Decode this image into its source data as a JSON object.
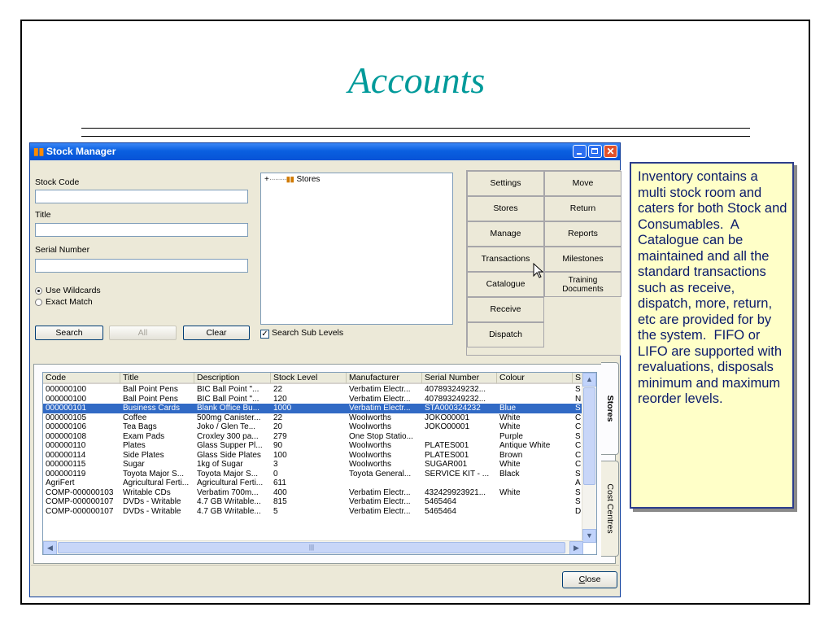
{
  "slide": {
    "title": "Accounts",
    "callout": "Inventory contains a multi stock room and caters for both Stock and Consumables.  A Catalogue can be maintained and all the standard transactions such as receive, dispatch, more, return, etc are provided for by the system.  FIFO or LIFO are supported with revaluations, disposals minimum and maximum reorder levels."
  },
  "window": {
    "title": "Stock Manager",
    "close_glyph": "✕"
  },
  "search_form": {
    "stock_code_label": "Stock Code",
    "stock_code_value": "",
    "title_label": "Title",
    "title_value": "",
    "serial_number_label": "Serial Number",
    "serial_number_value": "",
    "use_wildcards_label": "Use Wildcards",
    "exact_match_label": "Exact Match",
    "selected_match_mode": "Use Wildcards",
    "search_button": "Search",
    "all_button": "All",
    "clear_button": "Clear",
    "search_sub_levels_label": "Search Sub Levels",
    "search_sub_levels_checked": true
  },
  "tree": {
    "root_label": "Stores",
    "expand_glyph": "+"
  },
  "commands": {
    "settings": "Settings",
    "move": "Move",
    "stores": "Stores",
    "return": "Return",
    "manage": "Manage",
    "reports": "Reports",
    "transactions": "Transactions",
    "milestones": "Milestones",
    "catalogue": "Catalogue",
    "training_documents": "Training Documents",
    "receive": "Receive",
    "dispatch": "Dispatch"
  },
  "table": {
    "columns": [
      "Code",
      "Title",
      "Description",
      "Stock Level",
      "Manufacturer",
      "Serial Number",
      "Colour",
      "S"
    ],
    "rows": [
      [
        "000000100",
        "Ball Point Pens",
        "BIC Ball Point \"...",
        "22",
        "Verbatim Electr...",
        "407893249232...",
        "",
        "S"
      ],
      [
        "000000100",
        "Ball Point Pens",
        "BIC Ball Point \"...",
        "120",
        "Verbatim Electr...",
        "407893249232...",
        "",
        "N"
      ],
      [
        "000000101",
        "Business Cards",
        "Blank Office Bu...",
        "1000",
        "Verbatim Electr...",
        "STA000324232",
        "Blue",
        "S"
      ],
      [
        "000000105",
        "Coffee",
        "500mg Canister...",
        "22",
        "Woolworths",
        "JOKO00001",
        "White",
        "C"
      ],
      [
        "000000106",
        "Tea Bags",
        "Joko / Glen Te...",
        "20",
        "Woolworths",
        "JOKO00001",
        "White",
        "C"
      ],
      [
        "000000108",
        "Exam Pads",
        "Croxley 300 pa...",
        "279",
        "One Stop Statio...",
        "",
        "Purple",
        "S"
      ],
      [
        "000000110",
        "Plates",
        "Glass Supper Pl...",
        "90",
        "Woolworths",
        "PLATES001",
        "Antique White",
        "C"
      ],
      [
        "000000114",
        "Side Plates",
        "Glass Side Plates",
        "100",
        "Woolworths",
        "PLATES001",
        "Brown",
        "C"
      ],
      [
        "000000115",
        "Sugar",
        "1kg of Sugar",
        "3",
        "Woolworths",
        "SUGAR001",
        "White",
        "C"
      ],
      [
        "000000119",
        "Toyota Major S...",
        "Toyota Major S...",
        "0",
        "Toyota General...",
        "SERVICE KIT - ...",
        "Black",
        "S"
      ],
      [
        "AgriFert",
        "Agricultural Ferti...",
        "Agricultural Ferti...",
        "611",
        "",
        "",
        "",
        "A"
      ],
      [
        "COMP-000000103",
        "Writable CDs",
        "Verbatim 700m...",
        "400",
        "Verbatim Electr...",
        "432429923921...",
        "White",
        "S"
      ],
      [
        "COMP-000000107",
        "DVDs - Writable",
        "4.7 GB Writable...",
        "815",
        "Verbatim Electr...",
        "5465464",
        "",
        "S"
      ],
      [
        "COMP-000000107",
        "DVDs - Writable",
        "4.7 GB Writable...",
        "5",
        "Verbatim Electr...",
        "5465464",
        "",
        "D"
      ]
    ],
    "selected_row": 2
  },
  "side_tabs": {
    "stores": "Stores",
    "cost_centres": "Cost Centres"
  },
  "footer": {
    "close_first": "C",
    "close_rest": "lose"
  },
  "colors": {
    "title_teal": "#009a9a",
    "selection_blue": "#316ac5",
    "callout_fill": "#ffffc8",
    "callout_text": "#0a1a6b"
  }
}
